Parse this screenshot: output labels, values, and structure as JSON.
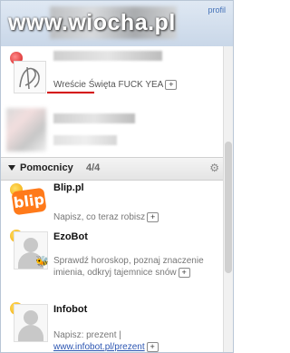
{
  "watermark": "www.wiocha.pl",
  "profile_link": "profil",
  "contacts": [
    {
      "status_text": "Wreście Święta FUCK YEA",
      "plus": "+"
    }
  ],
  "group": {
    "name": "Pomocnicy",
    "count": "4/4"
  },
  "bots": [
    {
      "name": "Blip.pl",
      "logo_text": "blip",
      "desc": "Napisz, co teraz robisz",
      "plus": "+"
    },
    {
      "name": "EzoBot",
      "desc_line1": "Sprawdź horoskop, poznaj znaczenie",
      "desc_line2": "imienia, odkryj tajemnice snów",
      "plus": "+"
    },
    {
      "name": "Infobot",
      "desc_line1": "Napisz: prezent |",
      "link": "www.infobot.pl/prezent",
      "plus": "+"
    }
  ],
  "colors": {
    "header_bg": "#dfe8f3",
    "link": "#2b55b2",
    "status_away": "#d21b1b",
    "status_online": "#f2a400",
    "blip_orange": "#ff7a1a"
  },
  "icons": [
    "status-busy-icon",
    "status-online-icon",
    "gear-icon",
    "expand-triangle-icon",
    "plus-icon"
  ]
}
